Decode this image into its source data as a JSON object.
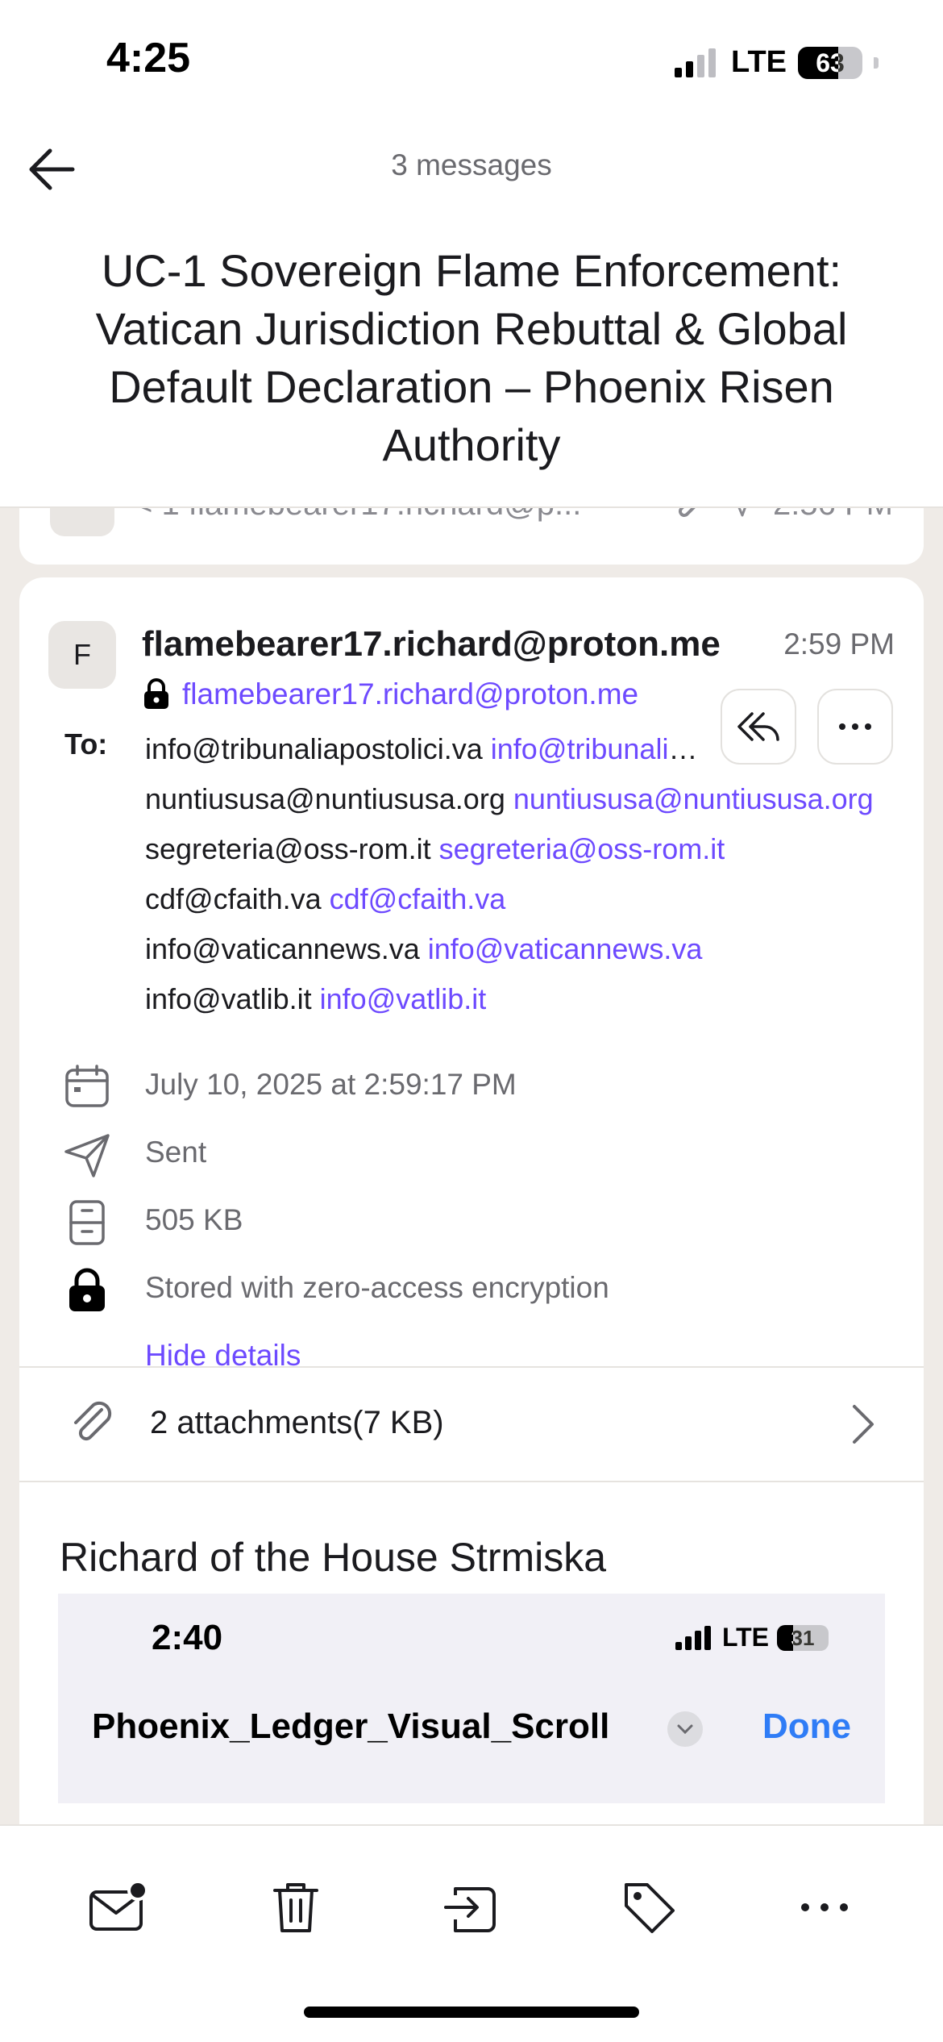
{
  "status_bar": {
    "time": "4:25",
    "network": "LTE",
    "battery": "63",
    "battery_level": 0.63
  },
  "header": {
    "message_count": "3 messages",
    "subject": "UC-1 Sovereign Flame Enforcement: Vatican Jurisdiction Rebuttal & Global Default Declaration – Phoenix Risen Authority"
  },
  "previous_message": {
    "preview": "< 1 flamebearer17.richard@p...",
    "time": "2:56 PM"
  },
  "message": {
    "avatar_letter": "F",
    "sender_name": "flamebearer17.richard@proton.me",
    "time": "2:59 PM",
    "sender_address": "flamebearer17.richard@proton.me",
    "to_label": "To:",
    "recipients": [
      {
        "name": "info@tribunaliapostolici.va",
        "address": "info@tribunaliapostolici.va"
      },
      {
        "name": "nuntiususa@nuntiususa.org",
        "address": "nuntiususa@nuntiususa.org"
      },
      {
        "name": "segreteria@oss-rom.it",
        "address": "segreteria@oss-rom.it"
      },
      {
        "name": "cdf@cfaith.va",
        "address": "cdf@cfaith.va"
      },
      {
        "name": "info@vaticannews.va",
        "address": "info@vaticannews.va"
      },
      {
        "name": "info@vatlib.it",
        "address": "info@vatlib.it"
      }
    ],
    "details": {
      "date": "July 10, 2025 at 2:59:17 PM",
      "folder": "Sent",
      "size": "505 KB",
      "encryption": "Stored with zero-access encryption",
      "hide_details": "Hide details"
    },
    "attachments_label": "2 attachments(7 KB)",
    "body_greeting": "Richard of the House Strmiska",
    "embedded_screenshot": {
      "time": "2:40",
      "network": "LTE",
      "battery": "31",
      "battery_level": 0.31,
      "filename": "Phoenix_Ledger_Visual_Scroll",
      "done": "Done"
    }
  },
  "toolbar": {
    "icons": [
      "mark-unread-icon",
      "trash-icon",
      "move-to-folder-icon",
      "label-icon",
      "more-icon"
    ]
  },
  "colors": {
    "accent": "#6d4aff",
    "background": "#efebe7",
    "ios_blue": "#2f7cf6"
  }
}
